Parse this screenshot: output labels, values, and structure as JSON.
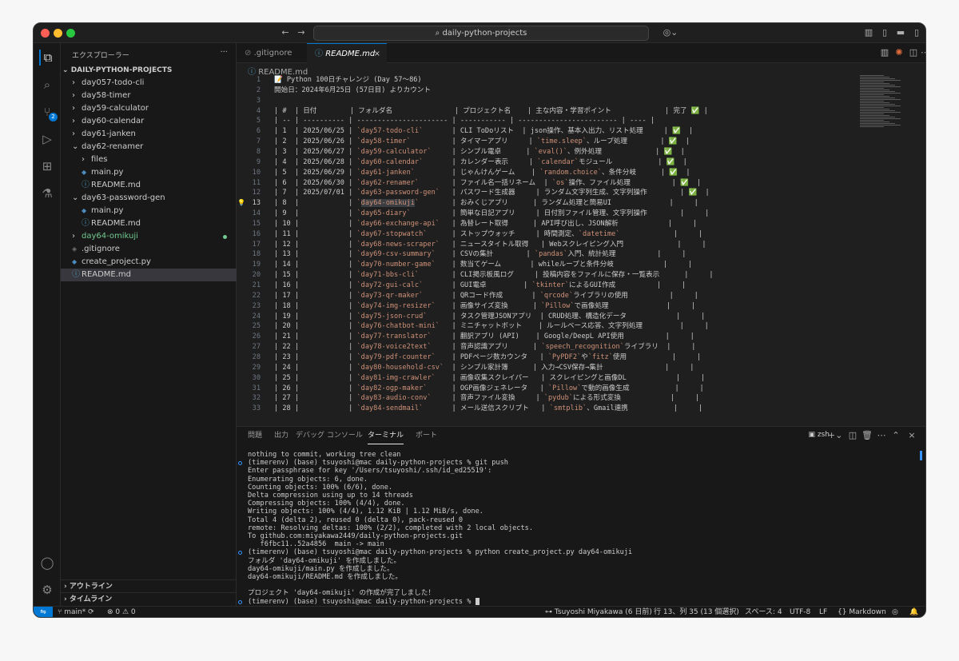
{
  "title_search": "daily-python-projects",
  "sidebar": {
    "header": "エクスプローラー",
    "more": "···",
    "root": "DAILY-PYTHON-PROJECTS",
    "items": [
      {
        "label": "day057-todo-cli",
        "kind": "folder",
        "depth": 1,
        "open": false
      },
      {
        "label": "day58-timer",
        "kind": "folder",
        "depth": 1,
        "open": false
      },
      {
        "label": "day59-calculator",
        "kind": "folder",
        "depth": 1,
        "open": false
      },
      {
        "label": "day60-calendar",
        "kind": "folder",
        "depth": 1,
        "open": false
      },
      {
        "label": "day61-janken",
        "kind": "folder",
        "depth": 1,
        "open": false
      },
      {
        "label": "day62-renamer",
        "kind": "folder",
        "depth": 1,
        "open": true
      },
      {
        "label": "files",
        "kind": "folder",
        "depth": 2,
        "open": false
      },
      {
        "label": "main.py",
        "kind": "py",
        "depth": 2
      },
      {
        "label": "README.md",
        "kind": "md",
        "depth": 2
      },
      {
        "label": "day63-password-gen",
        "kind": "folder",
        "depth": 1,
        "open": true
      },
      {
        "label": "main.py",
        "kind": "py",
        "depth": 2
      },
      {
        "label": "README.md",
        "kind": "md",
        "depth": 2
      },
      {
        "label": "day64-omikuji",
        "kind": "folder",
        "depth": 1,
        "open": false,
        "color": "#73c991"
      },
      {
        "label": ".gitignore",
        "kind": "git",
        "depth": 1
      },
      {
        "label": "create_project.py",
        "kind": "py",
        "depth": 1
      },
      {
        "label": "README.md",
        "kind": "md",
        "depth": 1,
        "selected": true
      }
    ],
    "outline": "アウトライン",
    "timeline": "タイムライン"
  },
  "tabs": [
    {
      "label": ".gitignore",
      "active": false
    },
    {
      "label": "README.md",
      "active": true
    }
  ],
  "breadcrumb": "README.md",
  "editor_lines": [
    {
      "n": "1",
      "t": "📝 Python 100日チャレンジ (Day 57〜86)"
    },
    {
      "n": "2",
      "t": "開始日：2024年6月25日 (57日目) よりカウント"
    },
    {
      "n": "3",
      "t": ""
    },
    {
      "n": "4",
      "t": "| #  | 日付        | フォルダ名               | プロジェクト名    | 主な内容・学習ポイント             | 完了 ✅ |"
    },
    {
      "n": "5",
      "t": "| -- | ---------- | ---------------------- | ----------- | ------------------------ | ---- |"
    },
    {
      "n": "6",
      "t": "| 1  | 2025/06/25 | `day57-todo-cli`       | CLI ToDoリスト  | json操作、基本入出力、リスト処理     | ✅  |"
    },
    {
      "n": "7",
      "t": "| 2  | 2025/06/26 | `day58-timer`          | タイマーアプリ     | `time.sleep`、ループ処理        | ✅  |"
    },
    {
      "n": "8",
      "t": "| 3  | 2025/06/27 | `day59-calculator`     | シンプル電卓      | `eval()`、例外処理             | ✅  |"
    },
    {
      "n": "9",
      "t": "| 4  | 2025/06/28 | `day60-calendar`       | カレンダー表示     | `calendar`モジュール           | ✅  |"
    },
    {
      "n": "10",
      "t": "| 5  | 2025/06/29 | `day61-janken`         | じゃんけんゲーム    | `random.choice`、条件分岐      | ✅  |"
    },
    {
      "n": "11",
      "t": "| 6  | 2025/06/30 | `day62-renamer`        | ファイル名一括リネーム  | `os`操作、ファイル処理          | ✅  |"
    },
    {
      "n": "12",
      "t": "| 7  | 2025/07/01 | `day63-password-gen`   | パスワード生成器     | ランダム文字列生成、文字列操作        | ✅  |"
    },
    {
      "n": "13",
      "t": "| 8  |            | `day64-omikuji`        | おみくじアプリ      | ランダム処理と簡易UI              |     |",
      "cur": true
    },
    {
      "n": "14",
      "t": "| 9  |            | `day65-diary`          | 簡単な日記アプリ     | 日付別ファイル管理、文字列操作        |     |"
    },
    {
      "n": "15",
      "t": "| 10 |            | `day66-exchange-api`   | 為替レート取得      | API呼び出し、JSON解析            |     |"
    },
    {
      "n": "16",
      "t": "| 11 |            | `day67-stopwatch`      | ストップウォッチ     | 時間測定、`datetime`             |     |"
    },
    {
      "n": "17",
      "t": "| 12 |            | `day68-news-scraper`   | ニュースタイトル取得   | Webスクレイピング入門             |     |"
    },
    {
      "n": "18",
      "t": "| 13 |            | `day69-csv-summary`    | CSVの集計        | `pandas`入門、統計処理          |     |"
    },
    {
      "n": "19",
      "t": "| 14 |            | `day70-number-game`    | 数当てゲーム       | whileループと条件分岐            |     |"
    },
    {
      "n": "20",
      "t": "| 15 |            | `day71-bbs-cli`        | CLI掲示板風ログ     | 投稿内容をファイルに保存・一覧表示      |     |"
    },
    {
      "n": "21",
      "t": "| 16 |            | `day72-gui-calc`       | GUI電卓         | `tkinter`によるGUI作成          |     |"
    },
    {
      "n": "22",
      "t": "| 17 |            | `day73-qr-maker`       | QRコード作成       | `qrcode`ライブラリの使用          |     |"
    },
    {
      "n": "23",
      "t": "| 18 |            | `day74-img-resizer`    | 画像サイズ変換      | `Pillow`で画像処理              |     |"
    },
    {
      "n": "24",
      "t": "| 19 |            | `day75-json-crud`      | タスク管理JSONアプリ  | CRUD処理、構造化データ            |     |"
    },
    {
      "n": "25",
      "t": "| 20 |            | `day76-chatbot-mini`   | ミニチャットボット    | ルールベース応答、文字列処理         |     |"
    },
    {
      "n": "26",
      "t": "| 21 |            | `day77-translator`     | 翻訳アプリ (API)    | Google/DeepL API使用          |     |"
    },
    {
      "n": "27",
      "t": "| 22 |            | `day78-voice2text`     | 音声認識アプリ      | `speech_recognition`ライブラリ  |     |"
    },
    {
      "n": "28",
      "t": "| 23 |            | `day79-pdf-counter`    | PDFページ数カウンタ   | `PyPDF2`や`fitz`使用           |     |"
    },
    {
      "n": "29",
      "t": "| 24 |            | `day80-household-csv`  | シンプル家計簿      | 入力→CSV保存→集計               |     |"
    },
    {
      "n": "30",
      "t": "| 25 |            | `day81-img-crawler`    | 画像収集スクレイパー   | スクレイピングと画像DL            |     |"
    },
    {
      "n": "31",
      "t": "| 26 |            | `day82-ogp-maker`      | OGP画像ジェネレータ   | `Pillow`で動的画像生成           |     |"
    },
    {
      "n": "32",
      "t": "| 27 |            | `day83-audio-conv`     | 音声ファイル変換     | `pydub`による形式変換            |     |"
    },
    {
      "n": "33",
      "t": "| 28 |            | `day84-sendmail`       | メール送信スクリプト   | `smtplib`、Gmail連携           |     |"
    }
  ],
  "panel": {
    "tabs": [
      "問題",
      "出力",
      "デバッグ コンソール",
      "ターミナル",
      "ポート"
    ],
    "active": 3,
    "shell": "zsh"
  },
  "terminal": [
    {
      "t": "nothing to commit, working tree clean",
      "dot": false
    },
    {
      "t": "(timerenv) (base) tsuyoshi@mac daily-python-projects % git push",
      "dot": true
    },
    {
      "t": "Enter passphrase for key '/Users/tsuyoshi/.ssh/id_ed25519':",
      "dot": false
    },
    {
      "t": "Enumerating objects: 6, done.",
      "dot": false
    },
    {
      "t": "Counting objects: 100% (6/6), done.",
      "dot": false
    },
    {
      "t": "Delta compression using up to 14 threads",
      "dot": false
    },
    {
      "t": "Compressing objects: 100% (4/4), done.",
      "dot": false
    },
    {
      "t": "Writing objects: 100% (4/4), 1.12 KiB | 1.12 MiB/s, done.",
      "dot": false
    },
    {
      "t": "Total 4 (delta 2), reused 0 (delta 0), pack-reused 0",
      "dot": false
    },
    {
      "t": "remote: Resolving deltas: 100% (2/2), completed with 2 local objects.",
      "dot": false
    },
    {
      "t": "To github.com:miyakawa2449/daily-python-projects.git",
      "dot": false
    },
    {
      "t": "   f6fbc11..52a4856  main -> main",
      "dot": false
    },
    {
      "t": "(timerenv) (base) tsuyoshi@mac daily-python-projects % python create_project.py day64-omikuji",
      "dot": true
    },
    {
      "t": "フォルダ 'day64-omikuji' を作成しました。",
      "dot": false
    },
    {
      "t": "day64-omikuji/main.py を作成しました。",
      "dot": false
    },
    {
      "t": "day64-omikuji/README.md を作成しました。",
      "dot": false
    },
    {
      "t": "",
      "dot": false
    },
    {
      "t": "プロジェクト 'day64-omikuji' の作成が完了しました！",
      "dot": false
    },
    {
      "t": "(timerenv) (base) tsuyoshi@mac daily-python-projects % ",
      "dot": true
    }
  ],
  "status": {
    "branch": "main*",
    "problems": "⊗ 0 ⚠ 0",
    "blame": "Tsuyoshi Miyakawa (6 日前)",
    "cursor": "行 13、列 35 (13 個選択)",
    "spaces": "スペース: 4",
    "encoding": "UTF-8",
    "eol": "LF",
    "language": "Markdown"
  },
  "colors": {
    "accent": "#0078d4",
    "folder_added": "#73c991",
    "string": "#ce9178"
  }
}
